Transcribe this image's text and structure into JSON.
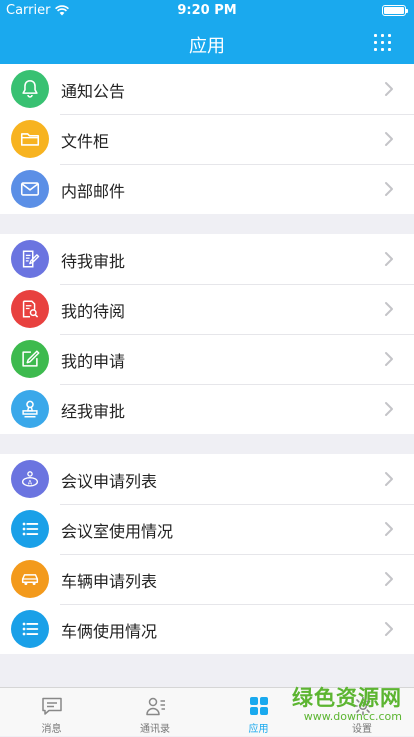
{
  "status_bar": {
    "carrier": "Carrier",
    "time": "9:20 PM"
  },
  "nav": {
    "title": "应用"
  },
  "groups": [
    [
      {
        "label": "通知公告",
        "icon": "bell-icon",
        "color": "#38c172"
      },
      {
        "label": "文件柜",
        "icon": "folder-icon",
        "color": "#f7b320"
      },
      {
        "label": "内部邮件",
        "icon": "mail-icon",
        "color": "#5b8fe6"
      }
    ],
    [
      {
        "label": "待我审批",
        "icon": "edit-doc-icon",
        "color": "#6b74e0"
      },
      {
        "label": "我的待阅",
        "icon": "search-doc-icon",
        "color": "#e8413f"
      },
      {
        "label": "我的申请",
        "icon": "pencil-square-icon",
        "color": "#3dba4e"
      },
      {
        "label": "经我审批",
        "icon": "stamp-icon",
        "color": "#3aa8ea"
      }
    ],
    [
      {
        "label": "会议申请列表",
        "icon": "meeting-icon",
        "color": "#6b74e0"
      },
      {
        "label": "会议室使用情况",
        "icon": "list-icon",
        "color": "#1aa0e8"
      },
      {
        "label": "车辆申请列表",
        "icon": "car-icon",
        "color": "#f39a1c"
      },
      {
        "label": "车俩使用情况",
        "icon": "list-icon",
        "color": "#1aa0e8"
      }
    ]
  ],
  "tabs": [
    {
      "label": "消息",
      "icon": "chat-icon"
    },
    {
      "label": "通讯录",
      "icon": "contacts-icon"
    },
    {
      "label": "应用",
      "icon": "apps-icon",
      "active": true
    },
    {
      "label": "设置",
      "icon": "gear-icon"
    }
  ],
  "colors": {
    "accent": "#1aa9ee"
  },
  "watermark": {
    "cn": "绿色资源网",
    "en": "www.downcc.com"
  }
}
